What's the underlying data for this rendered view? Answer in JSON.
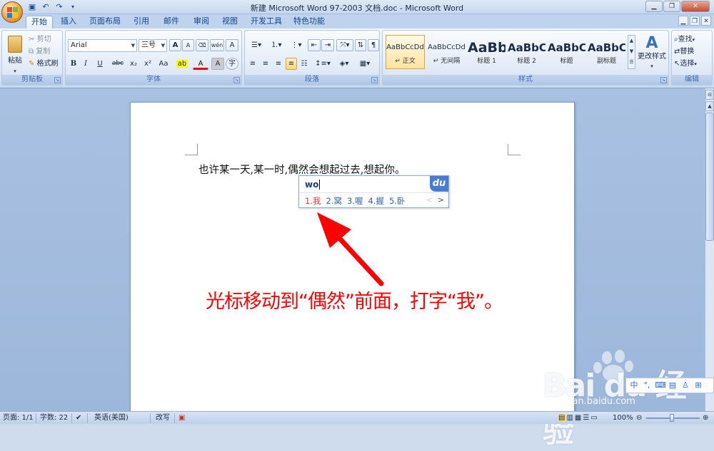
{
  "window": {
    "title": "新建 Microsoft Word 97-2003 文档.doc - Microsoft Word"
  },
  "qat": {
    "icons": [
      "save-icon",
      "undo-icon",
      "redo-icon"
    ]
  },
  "tabs": [
    "开始",
    "插入",
    "页面布局",
    "引用",
    "邮件",
    "审阅",
    "视图",
    "开发工具",
    "特色功能"
  ],
  "clipboard": {
    "paste": "粘贴",
    "cut": "剪切",
    "copy": "复制",
    "format_painter": "格式刷",
    "label": "剪贴板"
  },
  "font": {
    "name": "Arial",
    "size": "三号",
    "label": "字体",
    "bold": "B",
    "italic": "I",
    "underline": "U",
    "strike": "abc",
    "sub": "x₂",
    "sup": "x²",
    "case": "Aa",
    "font_color": "A",
    "grow": "A",
    "shrink": "A",
    "wen": "wén",
    "char_border": "A",
    "enclosed": "字"
  },
  "paragraph": {
    "label": "段落"
  },
  "styles": {
    "label": "样式",
    "items": [
      {
        "sample": "AaBbCcDd",
        "name": "↵ 正文"
      },
      {
        "sample": "AaBbCcDd",
        "name": "↵ 无间隔"
      },
      {
        "sample": "AaBb",
        "name": "标题 1"
      },
      {
        "sample": "AaBbC",
        "name": "标题 2"
      },
      {
        "sample": "AaBbC",
        "name": "标题"
      },
      {
        "sample": "AaBbC",
        "name": "副标题"
      }
    ],
    "change_styles": "更改样式"
  },
  "editing": {
    "find": "查找",
    "replace": "替换",
    "select": "选择",
    "label": "编辑"
  },
  "document": {
    "text": "也许某一天,某一时,偶然会想起过去,想起你。"
  },
  "ime": {
    "input": "wo",
    "logo": "du",
    "candidates": [
      "1.我",
      "2.窝",
      "3.喔",
      "4.握",
      "5.卧"
    ],
    "prev": "<",
    "next": ">"
  },
  "annotation": {
    "text": "光标移动到“偶然”前面，打字“我”。"
  },
  "status": {
    "page": "页面: 1/1",
    "words": "字数: 22",
    "language": "英语(美国)",
    "mode": "改写",
    "zoom": "100%"
  },
  "watermark": {
    "brand": "Bai du 经验",
    "url": "jingyan.baidu.com"
  }
}
